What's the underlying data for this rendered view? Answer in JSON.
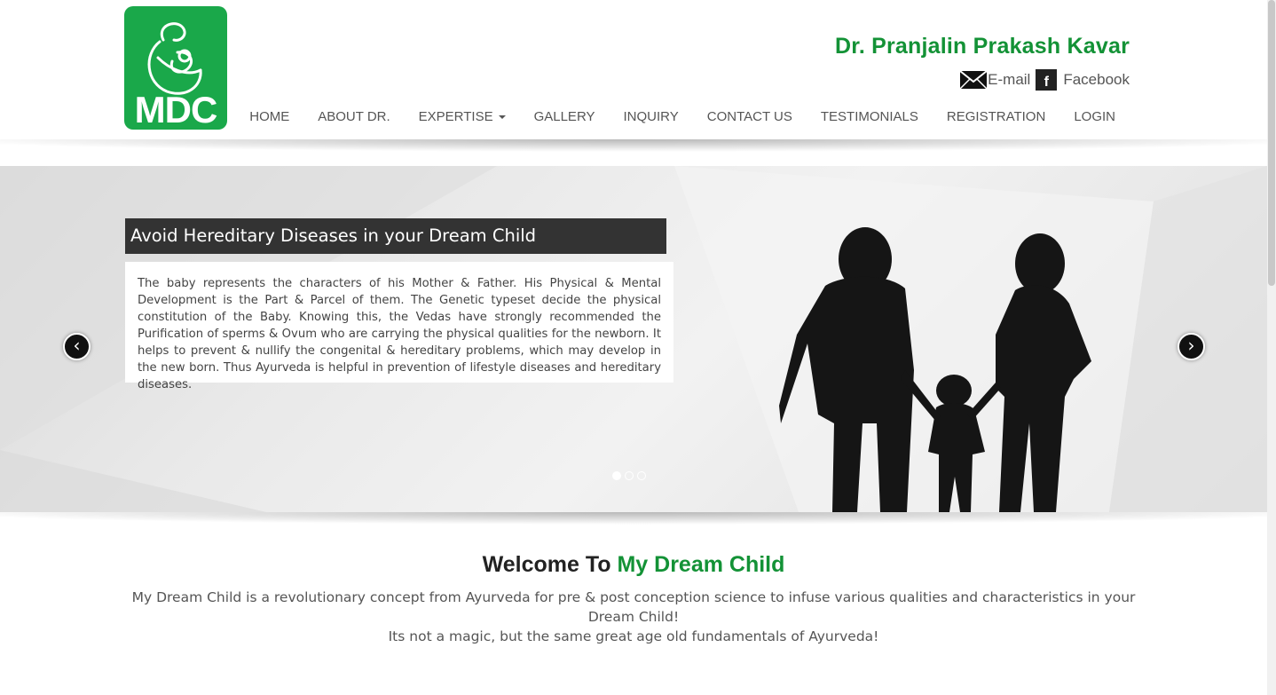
{
  "header": {
    "logo_text": "MDC",
    "doctor_name": "Dr. Pranjalin Prakash Kavar",
    "contacts": {
      "email_label": "E-mail",
      "facebook_label": "Facebook",
      "facebook_glyph": "f"
    },
    "nav": {
      "home": "HOME",
      "about": "ABOUT DR.",
      "expertise": "EXPERTISE",
      "gallery": "GALLERY",
      "inquiry": "INQUIRY",
      "contact": "CONTACT US",
      "testimonials": "TESTIMONIALS",
      "registration": "REGISTRATION",
      "login": "LOGIN"
    }
  },
  "slider": {
    "title": "Avoid Hereditary Diseases in your Dream Child",
    "body": "The baby represents the characters of his Mother & Father. His Physical & Mental Development is the Part & Parcel of them. The Genetic typeset decide the physical constitution of the Baby. Knowing this, the Vedas have strongly recommended the Purification of sperms & Ovum who are carrying the physical qualities for the newborn. It helps to prevent & nullify the congenital & hereditary problems, which may develop in the new born. Thus Ayurveda is helpful in prevention of lifestyle diseases and hereditary diseases.",
    "prev_glyph": "‹",
    "next_glyph": "›",
    "slide_count": 3,
    "active_slide": 1
  },
  "welcome": {
    "title_prefix": "Welcome To ",
    "title_accent": "My Dream Child",
    "line1": "My Dream Child is a revolutionary concept from Ayurveda for pre & post conception science to infuse various qualities and characteristics in your Dream Child!",
    "line2": "Its not a magic, but the same great age old fundamentals of Ayurveda!"
  },
  "colors": {
    "brand_green": "#1aa84a",
    "accent_green": "#139236",
    "caption_dark": "#333333"
  }
}
